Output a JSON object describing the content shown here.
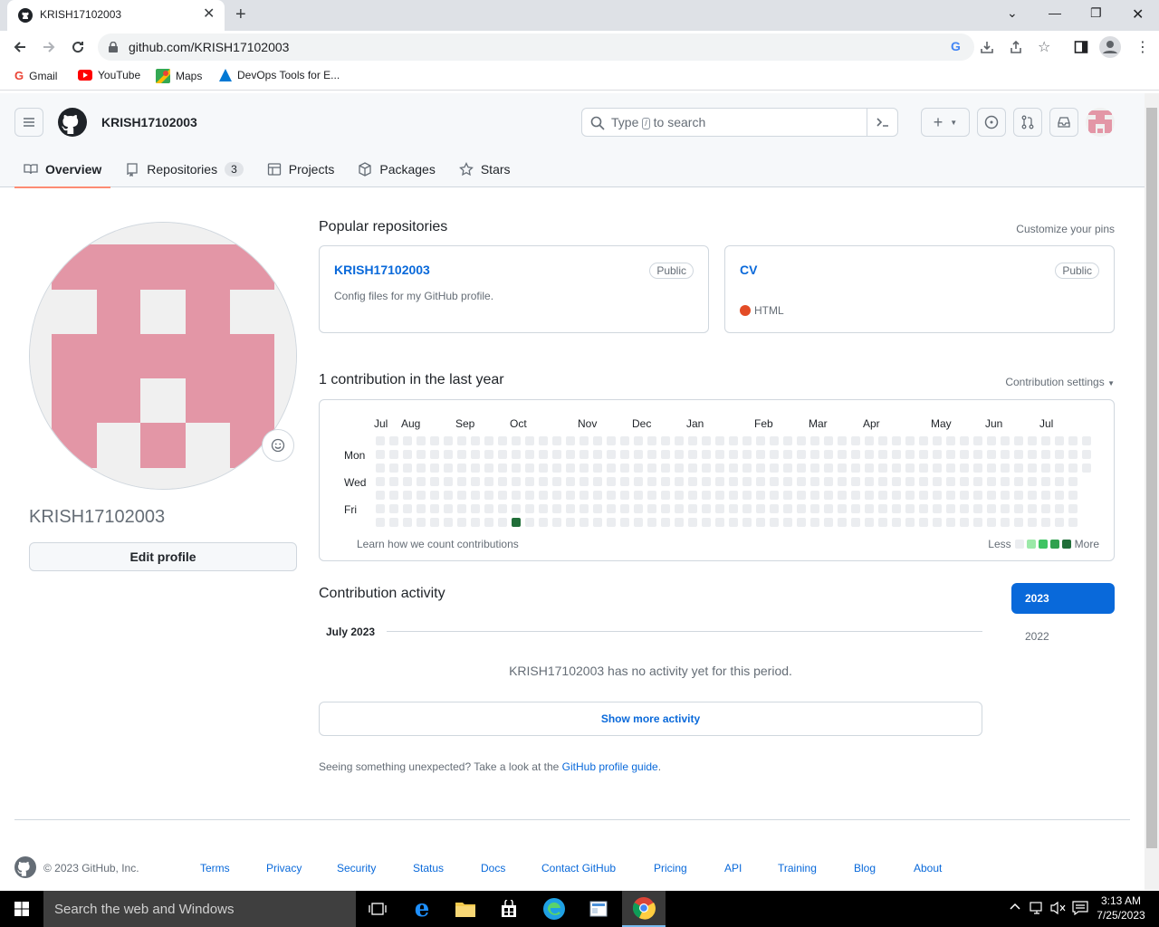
{
  "browser": {
    "tab_title": "KRISH17102003",
    "url": "github.com/KRISH17102003",
    "bookmarks": [
      {
        "label": "Gmail",
        "icon": "google-icon"
      },
      {
        "label": "YouTube",
        "icon": "youtube-icon"
      },
      {
        "label": "Maps",
        "icon": "maps-icon"
      },
      {
        "label": "DevOps Tools for E...",
        "icon": "devops-icon"
      }
    ]
  },
  "header": {
    "username": "KRISH17102003",
    "search_prefix": "Type",
    "search_key": "/",
    "search_suffix": "to search"
  },
  "nav": {
    "tabs": [
      {
        "label": "Overview",
        "icon": "book-icon"
      },
      {
        "label": "Repositories",
        "icon": "repo-icon",
        "count": "3"
      },
      {
        "label": "Projects",
        "icon": "table-icon"
      },
      {
        "label": "Packages",
        "icon": "package-icon"
      },
      {
        "label": "Stars",
        "icon": "star-icon"
      }
    ]
  },
  "profile": {
    "username": "KRISH17102003",
    "edit_label": "Edit profile"
  },
  "popular": {
    "title": "Popular repositories",
    "customize": "Customize your pins",
    "repos": [
      {
        "name": "KRISH17102003",
        "visibility": "Public",
        "description": "Config files for my GitHub profile.",
        "language": ""
      },
      {
        "name": "CV",
        "visibility": "Public",
        "description": "",
        "language": "HTML",
        "language_color": "#e34c26"
      }
    ]
  },
  "contributions": {
    "title": "1 contribution in the last year",
    "settings": "Contribution settings",
    "months": [
      "Jul",
      "Aug",
      "Sep",
      "Oct",
      "Nov",
      "Dec",
      "Jan",
      "Feb",
      "Mar",
      "Apr",
      "May",
      "Jun",
      "Jul"
    ],
    "days": [
      "Mon",
      "Wed",
      "Fri"
    ],
    "learn": "Learn how we count contributions",
    "less": "Less",
    "more": "More",
    "levels": [
      "#ebedf0",
      "#9be9a8",
      "#40c463",
      "#30a14e",
      "#216e39"
    ],
    "total_weeks": 53,
    "last_week_days": 3,
    "highlight": {
      "week": 10,
      "day": 6,
      "level": 4
    }
  },
  "activity": {
    "title": "Contribution activity",
    "period": "July 2023",
    "years": [
      "2023",
      "2022"
    ],
    "empty": "KRISH17102003 has no activity yet for this period.",
    "show_more": "Show more activity",
    "guide_text": "Seeing something unexpected? Take a look at the",
    "guide_link": "GitHub profile guide",
    "guide_end": "."
  },
  "footer": {
    "copyright": "© 2023 GitHub, Inc.",
    "links": [
      "Terms",
      "Privacy",
      "Security",
      "Status",
      "Docs",
      "Contact GitHub",
      "Pricing",
      "API",
      "Training",
      "Blog",
      "About"
    ]
  },
  "taskbar": {
    "search_placeholder": "Search the web and Windows",
    "time": "3:13 AM",
    "date": "7/25/2023"
  }
}
